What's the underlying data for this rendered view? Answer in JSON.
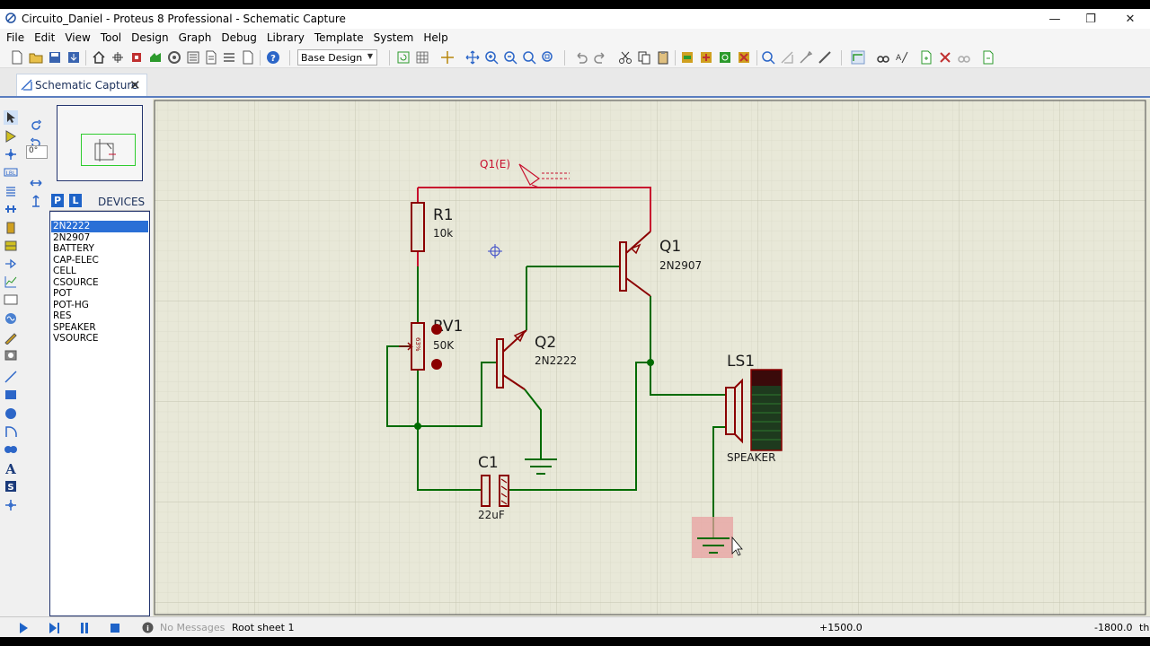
{
  "window": {
    "title": "Circuito_Daniel - Proteus 8 Professional - Schematic Capture"
  },
  "menu": [
    "File",
    "Edit",
    "View",
    "Tool",
    "Design",
    "Graph",
    "Debug",
    "Library",
    "Template",
    "System",
    "Help"
  ],
  "toolbar": {
    "design_select": "Base Design"
  },
  "tab": {
    "label": "Schematic Capture"
  },
  "rotation": {
    "value": "0°"
  },
  "devices": {
    "p_label": "P",
    "l_label": "L",
    "title": "DEVICES",
    "items": [
      "2N2222",
      "2N2907",
      "BATTERY",
      "CAP-ELEC",
      "CELL",
      "CSOURCE",
      "POT",
      "POT-HG",
      "RES",
      "SPEAKER",
      "VSOURCE"
    ],
    "selected": "2N2222"
  },
  "schematic": {
    "probe": "Q1(E)",
    "r1": {
      "ref": "R1",
      "value": "10k"
    },
    "rv1": {
      "ref": "RV1",
      "value": "50K",
      "percent": "63%"
    },
    "q1": {
      "ref": "Q1",
      "value": "2N2907"
    },
    "q2": {
      "ref": "Q2",
      "value": "2N2222"
    },
    "c1": {
      "ref": "C1",
      "value": "22uF"
    },
    "ls1": {
      "ref": "LS1",
      "value": "SPEAKER"
    },
    "colors": {
      "wire_hi": "#c8102e",
      "wire_lo": "#006b00",
      "component": "#8b0000",
      "grid_bg": "#e8e8d8"
    }
  },
  "status": {
    "messages": "No Messages",
    "sheet": "Root sheet 1",
    "coord_x": "+1500.0",
    "coord_y": "-1800.0",
    "unit": "th"
  }
}
